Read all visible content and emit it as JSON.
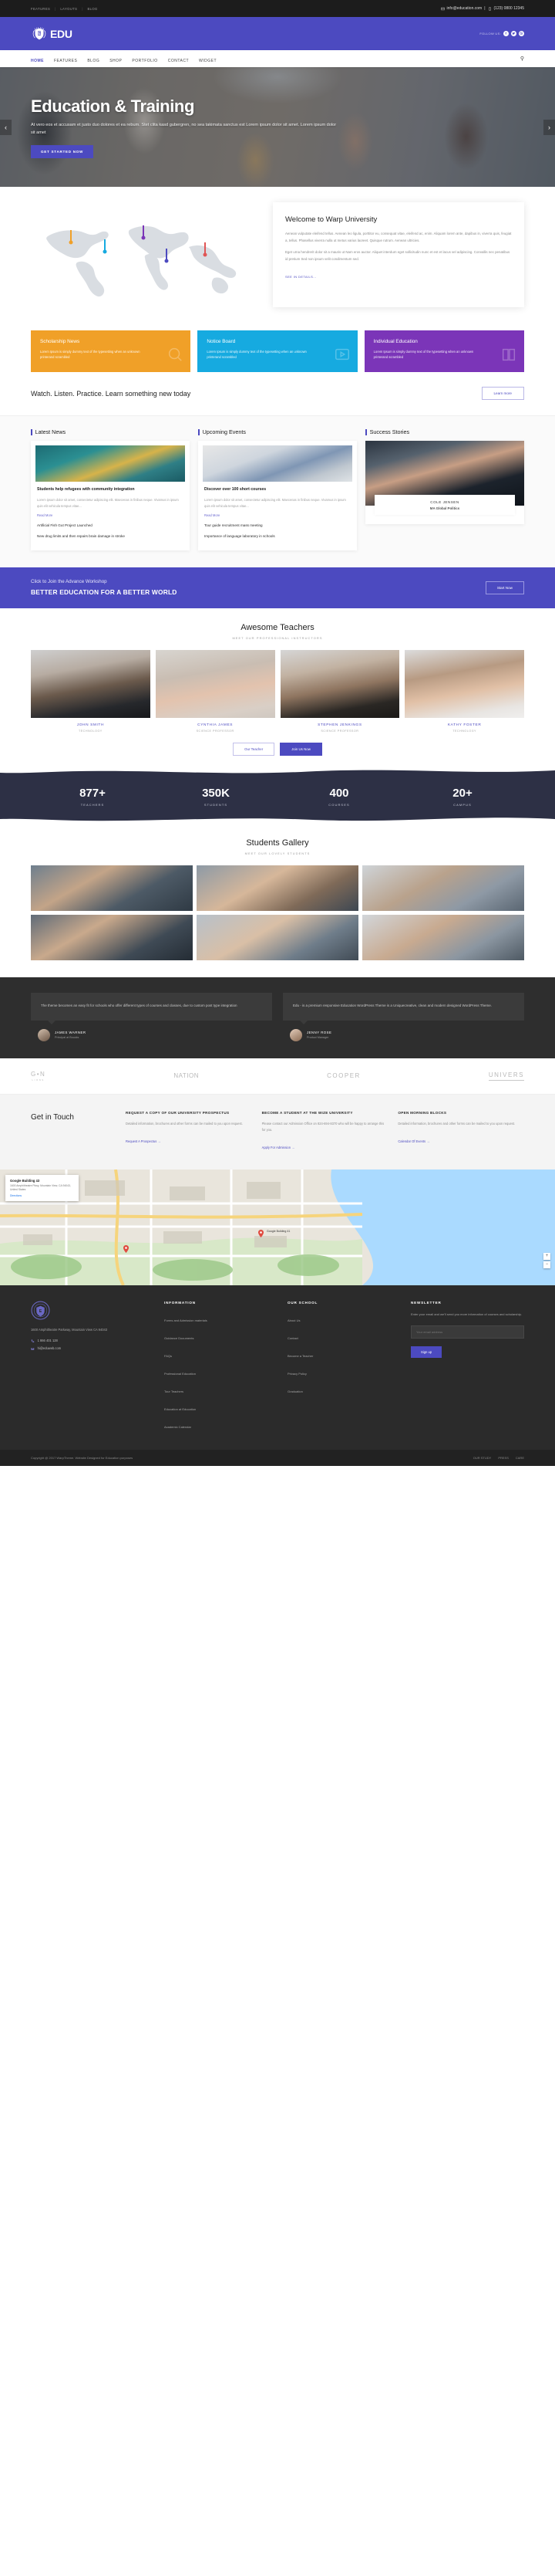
{
  "topbar": {
    "links": [
      "FEATURES",
      "LAYOUTS",
      "BLOG"
    ],
    "email": "info@education.com",
    "phone": "(123) 0800 12345"
  },
  "brand": {
    "name": "EDU",
    "follow_label": "FOLLOW US:"
  },
  "nav": {
    "items": [
      "HOME",
      "FEATURES",
      "BLOG",
      "SHOP",
      "PORTFOLIO",
      "CONTACT",
      "WIDGET"
    ],
    "active": "HOME",
    "search_icon": "search-icon"
  },
  "hero": {
    "title": "Education & Training",
    "body": "At vero eos et accusam et justo duo dolores et ea rebum. Stet clita kasd gubergren, no sea takimata sanctus est Lorem ipsum dolor sit amet. Lorem ipsum dolor sit amet",
    "cta": "GET STARTED NOW",
    "prev": "‹",
    "next": "›"
  },
  "welcome": {
    "title": "Welcome to Warp University",
    "para1": "Aenean vulputate eleifend tellus. Aenean leo ligula, porttitor eu, consequat vitae, eleifend ac, enim. Aliquam lorem ante, dapibus in, viverra quis, feugiat a, tellus. Phasellus viverra nulla ut metus varius laoreet. Quisque rutrum. Aenean ultricies.",
    "para2": "Eget urna hendrerit dolor sit a mauris ut Nam eros auctor. Aliquet interdum eget sollicitudin nunc et est et lacus vel adipiscing. Convallis nec penatibus id pretium Sed non ipsum velit condimentum sed.",
    "link": "SEE IN DETAILS..."
  },
  "feature_cards": [
    {
      "title": "Scholarship News",
      "text": "Lorem Ipsum is simply dummy text of the typesetting when an unknown printerand scrambled",
      "color": "#f0a028",
      "icon": "magnifier-icon"
    },
    {
      "title": "Notice Board",
      "text": "Lorem Ipsum is simply dummy text of the typesetting when an unknown printerand scrambled",
      "color": "#16aae0",
      "icon": "video-board-icon"
    },
    {
      "title": "Individual Education",
      "text": "Lorem Ipsum is simply dummy text of the typesetting when an unknown printerand scrambled",
      "color": "#7b35b8",
      "icon": "book-icon"
    }
  ],
  "cta_strip": {
    "title": "Watch. Listen. Practice. Learn something new today",
    "button": "Learn more"
  },
  "latest_news": {
    "heading": "Latest News",
    "card": {
      "title": "Students help refugees with community integration",
      "excerpt": "Lorem ipsum dolor sit amet, consectetur adipiscing elit. Maecenas in finibus neque. Vivamus in ipsum quis elit vehicula tempus vitae...",
      "read_more": "Read More"
    },
    "extras": [
      "Artificial Fish Gut Project Launched",
      "New drug limits and then repairs brain damage in stroke"
    ]
  },
  "upcoming_events": {
    "heading": "Upcoming Events",
    "card": {
      "title": "Discover over 100 short courses",
      "excerpt": "Lorem ipsum dolor sit amet, consectetur adipiscing elit. Maecenas in finibus neque. Vivamus in ipsum quis elit vehicula tempus vitae...",
      "read_more": "Read More"
    },
    "extras": [
      "Tour guide recruitment mass meeting",
      "Importance of language laboratory in schools"
    ]
  },
  "success_stories": {
    "heading": "Success Stories",
    "person_name": "COLE JENSEN",
    "person_role": "MA Global Politics"
  },
  "workshop": {
    "line1": "Click to Join the Advance Workshop",
    "line2": "BETTER EDUCATION FOR A BETTER WORLD",
    "button": "Start Now"
  },
  "teachers": {
    "title": "Awesome Teachers",
    "subtitle": "MEET OUR PROFESSIONAL INSTRUCTORS",
    "members": [
      {
        "name": "JOHN SMITH",
        "role": "TECHNOLOGY"
      },
      {
        "name": "CYNTHIA JAMES",
        "role": "SCIENCE PROFESSOR"
      },
      {
        "name": "STEPHEN JENKINGS",
        "role": "SCIENCE PROFESSOR"
      },
      {
        "name": "KATHY FOSTER",
        "role": "TECHNOLOGY"
      }
    ],
    "btn_outline": "Our Teacher",
    "btn_filled": "Join Us Now"
  },
  "stats": [
    {
      "value": "877+",
      "label": "TEACHERS"
    },
    {
      "value": "350K",
      "label": "STUDENTS"
    },
    {
      "value": "400",
      "label": "COURSES"
    },
    {
      "value": "20+",
      "label": "CAMPUS"
    }
  ],
  "gallery": {
    "title": "Students Gallery",
    "subtitle": "MEET OUR LOVELY STUDENTS"
  },
  "testimonials": [
    {
      "quote": "The theme becomes an easy fit for schools who offer different types of courses and classes, due to custom post type integration",
      "name": "JAMES WARNER",
      "position": "Principal at Boucks"
    },
    {
      "quote": "Edu - is a premium responsive Education WordPress Theme is a Uniquecreative, clean and modern designed WordPress Theme.",
      "name": "JENNY ROSE",
      "position": "Product Manager"
    }
  ],
  "brands": [
    {
      "text": "G•N",
      "sub": "LIONS"
    },
    {
      "text": "NATION",
      "sub": ""
    },
    {
      "text": "COOPER",
      "sub": ""
    },
    {
      "text": "UNIVERS",
      "sub": ""
    }
  ],
  "touch": {
    "title": "Get in Touch",
    "columns": [
      {
        "head": "REQUEST A COPY OF OUR UNIVERSITY PROSPECTUS",
        "body": "Detailed information, brochures and other forms can be mailed to you upon request.",
        "link": "Request A Prospectus →"
      },
      {
        "head": "BECOME A STUDENT AT THE WIZE UNIVERSITY",
        "body": "Please contact our Admission Office on 824-694-8370 who will be happy to arrange this for you.",
        "link": "Apply For Admission →"
      },
      {
        "head": "OPEN MORNING BLOCKS",
        "body": "Detailed information, brochures and other forms can be mailed to you upon request.",
        "link": "Calendar Of Events →"
      }
    ]
  },
  "map": {
    "card_title": "Google Building 43",
    "card_sub": "1600 Amphitheatre Pkwy, Mountain View, CA 94043, United States",
    "card_link": "Directions",
    "pin_label": "Google Building 41",
    "zoom_in": "+",
    "zoom_out": "−"
  },
  "footer": {
    "address": "1600 Amphitheatre Parkway, Mountain View CA 94043",
    "phone": "1 866 401 128",
    "email": "hi@eduweb.com",
    "col2": {
      "head": "INFORMATION",
      "items": [
        "Forms and Admission materials",
        "Guidance Documents",
        "FAQs",
        "Professional Education",
        "Tour Teachers",
        "Education at Education",
        "Academic Calendar"
      ]
    },
    "col3": {
      "head": "OUR SCHOOL",
      "items": [
        "About Us",
        "Contact",
        "Become a Teacher",
        "Privacy Policy",
        "Graduation"
      ]
    },
    "col4": {
      "head": "NEWSLETTER",
      "text": "Enter your email and we'll send you more information of courses and scholarship.",
      "placeholder": "Your email address",
      "button": "Sign up"
    }
  },
  "copyright": {
    "text": "Copyright @ 2017 WarpTheme. Website Designed for Education purposes",
    "links": [
      "OUR STUDY",
      "PRESS",
      "CARE"
    ]
  }
}
